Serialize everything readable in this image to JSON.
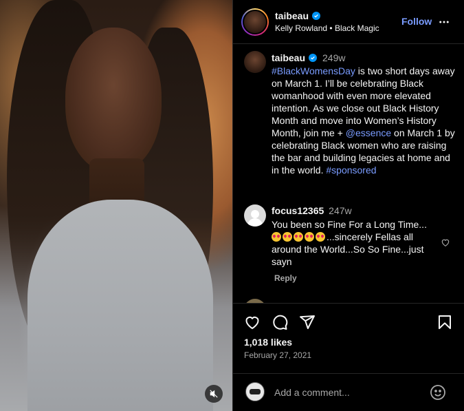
{
  "post": {
    "username": "taibeau",
    "subtitle_name": "Kelly Rowland",
    "subtitle_sep": "•",
    "subtitle_audio": "Black Magic",
    "follow_label": "Follow"
  },
  "caption": {
    "username": "taibeau",
    "time": "249w",
    "hashtag1": "#BlackWomensDay",
    "text1": " is two short days away on March 1. I’ll be celebrating Black womanhood with even more elevated intention. As we close out Black History Month and move into Women’s History Month, join me + ",
    "mention": "@essence",
    "text2": " on March 1 by celebrating Black women who are raising the bar and building legacies at home and in the world.",
    "hashtag2": "#sponsored"
  },
  "comment": {
    "username": "focus12365",
    "time": "247w",
    "text_before": "You been so Fine For a Long Time...",
    "emoji_count": 5,
    "text_after": "...sincerely Fellas all around the World...So So Fine...just sayn",
    "reply_label": "Reply"
  },
  "stats": {
    "likes": "1,018 likes",
    "date": "February 27, 2021"
  },
  "composer": {
    "placeholder": "Add a comment..."
  },
  "icons": {
    "verified": "verified-badge-icon",
    "more": "more-options-icon",
    "mute": "muted-speaker-icon",
    "like": "heart-icon",
    "comment": "comment-bubble-icon",
    "share": "paper-plane-icon",
    "save": "bookmark-icon",
    "emoji": "smiley-icon"
  },
  "colors": {
    "accent": "#7a9cff",
    "verified": "#0095f6",
    "muted": "#a8a8a8"
  }
}
